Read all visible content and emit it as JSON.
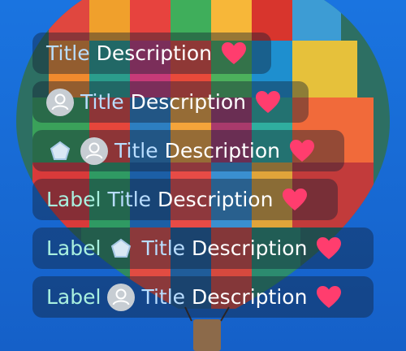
{
  "rows": [
    {
      "title": "Title",
      "description": "Description"
    },
    {
      "title": "Title",
      "description": "Description"
    },
    {
      "title": "Title",
      "description": "Description"
    },
    {
      "label": "Label",
      "title": "Title",
      "description": "Description"
    },
    {
      "label": "Label",
      "title": "Title",
      "description": "Description"
    },
    {
      "label": "Label",
      "title": "Title",
      "description": "Description"
    }
  ],
  "icons": {
    "avatar": "person-avatar-icon",
    "badge": "pentagon-icon",
    "trailing": "heart-icon"
  },
  "colors": {
    "title": "#b9ddff",
    "description": "#ffffff",
    "label": "#a9f0df",
    "heart": "#ff3d6e",
    "background": "#1a6fd6"
  }
}
